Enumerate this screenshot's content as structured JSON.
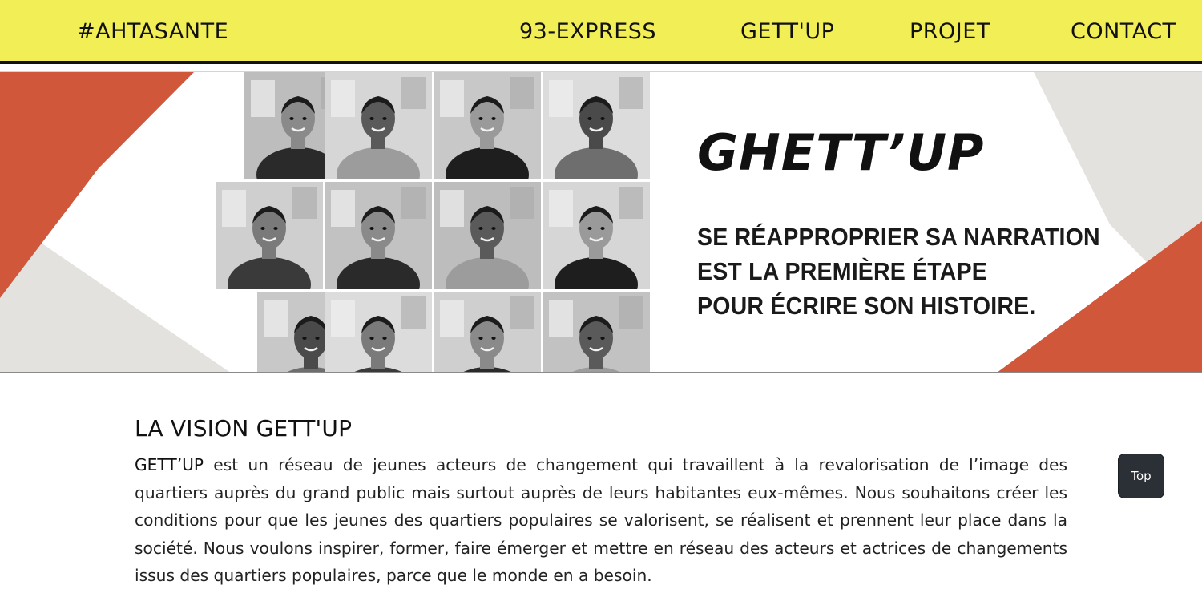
{
  "nav": {
    "brand": "#AHTASANTE",
    "links": [
      "93-EXPRESS",
      "GETT'UP",
      "PROJET",
      "CONTACT"
    ]
  },
  "banner": {
    "title": "GHETT’UP",
    "tagline": [
      "SE RÉAPPROPRIER SA NARRATION",
      "EST LA PREMIÈRE ÉTAPE",
      "POUR ÉCRIRE SON HISTOIRE."
    ],
    "colors": {
      "accent_orange": "#d0573a",
      "beige": "#e4e2de"
    }
  },
  "vision": {
    "title": "LA VISION GETT'UP",
    "lead": "GETT’UP",
    "body": " est un réseau de jeunes acteurs de changement qui travaillent à la revalorisation de l’image des quartiers auprès du grand public mais surtout auprès de leurs habitantes eux-mêmes. Nous souhaitons créer les conditions pour que les jeunes des quartiers populaires se valorisent, se réalisent et prennent leur place dans la société. Nous voulons inspirer, former, faire émerger et mettre en réseau des acteurs et actrices de changements issus des quartiers populaires, parce que le monde en a besoin."
  },
  "top_button": {
    "label": "Top"
  },
  "colors": {
    "nav_bg": "#f2ee55",
    "button_bg": "#2b2f36"
  }
}
